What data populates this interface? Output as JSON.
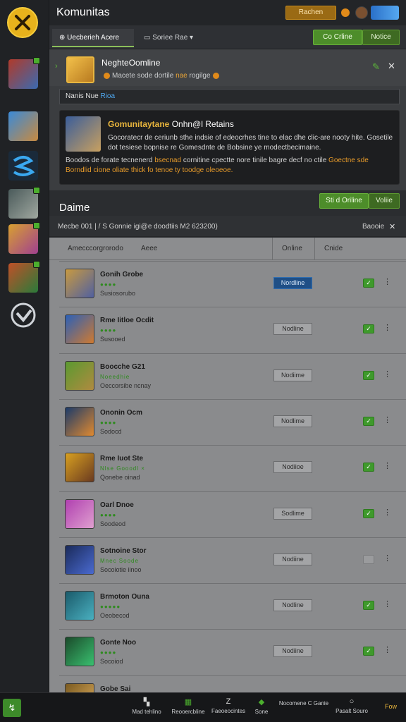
{
  "app": {
    "title": "Komunitas"
  },
  "topbar": {
    "button_label": "Rachen"
  },
  "subbar": {
    "tabs": [
      {
        "label": "Uecberieh Acere",
        "active": true
      },
      {
        "label": "Soriee Rae",
        "active": false
      }
    ],
    "online_button": "Co Crline",
    "edit_button": "Notice"
  },
  "notification": {
    "title": "NeghteOomline",
    "subtitle_prefix": "Macete sode dortile",
    "subtitle_highlight": "nae",
    "subtitle_suffix": "rogilge",
    "input_value_prefix": "Nanis Nue ",
    "input_value_blue": "Rioa",
    "card": {
      "title_gold": "Gomunitaytane",
      "title_white": "Onhn@l Retains",
      "text": "Gocoratecr de ceriunb sthe indsie of edeocrhes tine to elac dhe clic-are nooty hite. Gosetile dot tesiese bopnise re Gomesdnte de Bobsine ye modectbecimaine.",
      "text2_a": "Boodos de forate tecnenerd",
      "text2_b": "bsecnad",
      "text2_c": "cornitine cpectte nore tinile bagre decf no ctile",
      "text2_d": "Goectne sde",
      "text2_e": "Borndlid cione oliate thick fo tenoe ty toodge oleoeoe."
    }
  },
  "section": {
    "title": "Daime",
    "online_button": "Sti d Oriline",
    "edit_button": "Voliie",
    "filter_text": "Mecbe 001 | / S Gonnie igi@e doodtiis M2 623200)",
    "filter_right": "Baooie"
  },
  "table": {
    "headers": [
      "Amecccorgrorodo",
      "Aeee",
      "Online",
      "Cnide"
    ],
    "rows": [
      {
        "name": "Gonih Grobe",
        "dots": "●●●●",
        "sub": "Susiosorubo",
        "status": "Nordline",
        "status_style": "blue",
        "checked": true
      },
      {
        "name": "Rme Iitloe Ocdit",
        "dots": "●●●●",
        "sub": "Susooed",
        "status": "Nodline",
        "status_style": "grey",
        "checked": true
      },
      {
        "name": "Boocche G21",
        "dots": "Noeedhie",
        "sub": "Oeccorsibe ncnay",
        "status": "Nodiime",
        "status_style": "grey",
        "checked": true
      },
      {
        "name": "Ononin Ocm",
        "dots": "●●●●",
        "sub": "Sodocd",
        "status": "Nodlime",
        "status_style": "grey",
        "checked": true
      },
      {
        "name": "Rme Iuot Ste",
        "dots": "Nlse Gooodl ×",
        "sub": "Qonebe oinad",
        "status": "Nodiioe",
        "status_style": "grey",
        "checked": true
      },
      {
        "name": "Oarl Dnoe",
        "dots": "●●●●",
        "sub": "Soodeod",
        "status": "Sodlime",
        "status_style": "grey",
        "checked": true
      },
      {
        "name": "Sotnoine Stor",
        "dots": "Mnec Soode",
        "sub": "Socoiotie iinoo",
        "status": "Nodiine",
        "status_style": "grey",
        "checked": false
      },
      {
        "name": "Brmoton Ouna",
        "dots": "●●●●●",
        "sub": "Oeobecod",
        "status": "Nodline",
        "status_style": "grey",
        "checked": true
      },
      {
        "name": "Gonte Noo",
        "dots": "●●●●",
        "sub": "Socoiod",
        "status": "Nodiine",
        "status_style": "grey",
        "checked": true
      },
      {
        "name": "Gobe Sai",
        "dots": "",
        "sub": "",
        "status": "",
        "status_style": "grey",
        "checked": false
      }
    ]
  },
  "bottombar": {
    "items": [
      {
        "label": "Mad tehlino",
        "icon": "chart-icon"
      },
      {
        "label": "Reooercbline",
        "icon": "grid-icon"
      },
      {
        "label": "Faeoeocintes",
        "icon": "z-icon"
      },
      {
        "label": "Sone",
        "icon": "diamond-icon"
      },
      {
        "label": "Nocomene C Ganie",
        "icon": ""
      },
      {
        "label": "Pasalt Souro",
        "icon": "circle-icon"
      }
    ],
    "end_label": "Fow"
  }
}
